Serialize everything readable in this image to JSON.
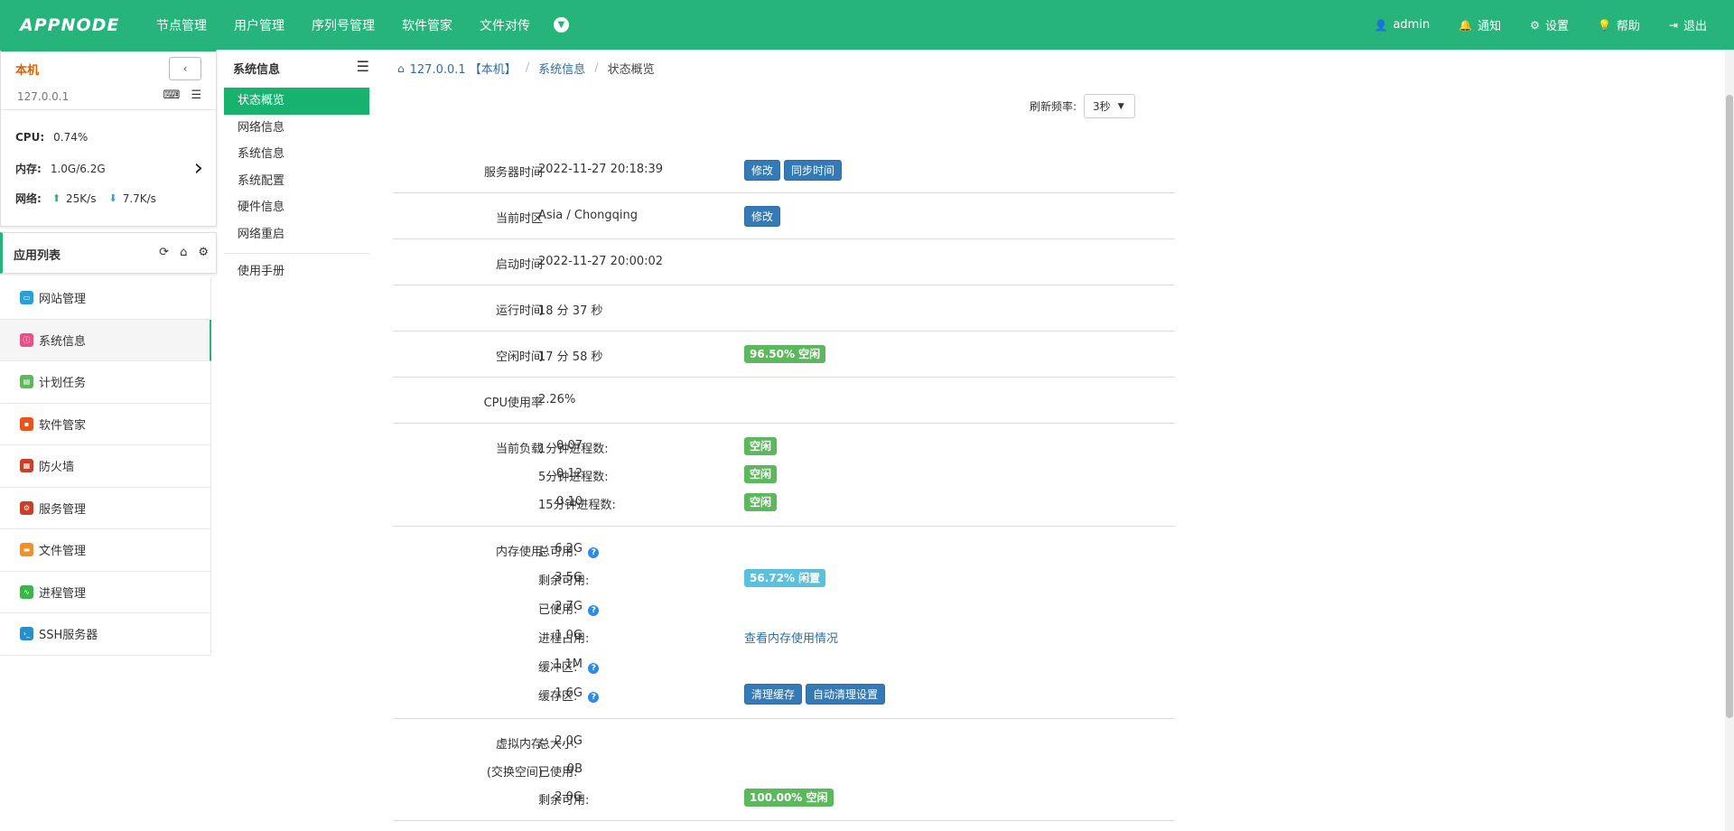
{
  "header": {
    "logo": "APPNODE",
    "nav": [
      "节点管理",
      "用户管理",
      "序列号管理",
      "软件管家",
      "文件对传"
    ],
    "right": [
      {
        "icon": "user-icon",
        "label": "admin"
      },
      {
        "icon": "bell-icon",
        "label": "通知"
      },
      {
        "icon": "gear-icon",
        "label": "设置"
      },
      {
        "icon": "lightbulb-icon",
        "label": "帮助"
      },
      {
        "icon": "logout-icon",
        "label": "退出"
      }
    ]
  },
  "host": {
    "name": "本机",
    "ip": "127.0.0.1",
    "cpu_label": "CPU:",
    "cpu": "0.74%",
    "mem_label": "内存:",
    "mem": "1.0G/6.2G",
    "net_label": "网络:",
    "net_up": "25K/s",
    "net_down": "7.7K/s"
  },
  "applist": {
    "title": "应用列表",
    "items": [
      {
        "label": "网站管理",
        "color": "#2a9fd6"
      },
      {
        "label": "系统信息",
        "color": "#e8508a"
      },
      {
        "label": "计划任务",
        "color": "#5cb85c"
      },
      {
        "label": "软件管家",
        "color": "#e8541c"
      },
      {
        "label": "防火墙",
        "color": "#c9402a"
      },
      {
        "label": "服务管理",
        "color": "#c9402a"
      },
      {
        "label": "文件管理",
        "color": "#f0902a"
      },
      {
        "label": "进程管理",
        "color": "#3cb44a"
      },
      {
        "label": "SSH服务器",
        "color": "#2a8fc6"
      }
    ]
  },
  "submenu": {
    "title": "系统信息",
    "items": [
      "状态概览",
      "网络信息",
      "系统信息",
      "系统配置",
      "硬件信息",
      "网络重启"
    ],
    "manual": "使用手册"
  },
  "breadcrumb": {
    "host": "127.0.0.1 【本机】",
    "section": "系统信息",
    "current": "状态概览"
  },
  "refresh": {
    "label": "刷新频率:",
    "value": "3秒"
  },
  "info": {
    "server_time": {
      "label": "服务器时间",
      "value": "2022-11-27 20:18:39",
      "btn_edit": "修改",
      "btn_sync": "同步时间"
    },
    "timezone": {
      "label": "当前时区",
      "value": "Asia / Chongqing",
      "btn_edit": "修改"
    },
    "boot_time": {
      "label": "启动时间",
      "value": "2022-11-27 20:00:02"
    },
    "uptime": {
      "label": "运行时间",
      "value": "18 分 37 秒"
    },
    "idle_time": {
      "label": "空闲时间",
      "value": "17 分 58 秒",
      "badge": "96.50% 空闲"
    },
    "cpu_usage": {
      "label": "CPU使用率",
      "value": "2.26%"
    },
    "load": {
      "label": "当前负载",
      "rows": [
        {
          "label": "1分钟进程数:",
          "value": "0.07",
          "badge": "空闲"
        },
        {
          "label": "5分钟进程数:",
          "value": "0.12",
          "badge": "空闲"
        },
        {
          "label": "15分钟进程数:",
          "value": "0.10",
          "badge": "空闲"
        }
      ]
    },
    "memory": {
      "label": "内存使用",
      "rows": [
        {
          "label": "总可用:",
          "value": "6.2G"
        },
        {
          "label": "剩余可用:",
          "value": "3.5G",
          "badge": "56.72% 闲置"
        },
        {
          "label": "已使用:",
          "value": "2.7G"
        },
        {
          "label": "进程占用:",
          "value": "1.0G",
          "link": "查看内存使用情况"
        },
        {
          "label": "缓冲区:",
          "value": "1.1M"
        },
        {
          "label": "缓存区:",
          "value": "1.6G",
          "btn_clear": "清理缓存",
          "btn_auto": "自动清理设置"
        }
      ]
    },
    "swap": {
      "label": "虚拟内存",
      "label2": "(交换空间)",
      "rows": [
        {
          "label": "总大小:",
          "value": "2.0G"
        },
        {
          "label": "已使用:",
          "value": "0B"
        },
        {
          "label": "剩余可用:",
          "value": "2.0G",
          "badge": "100.00% 空闲"
        }
      ]
    }
  }
}
